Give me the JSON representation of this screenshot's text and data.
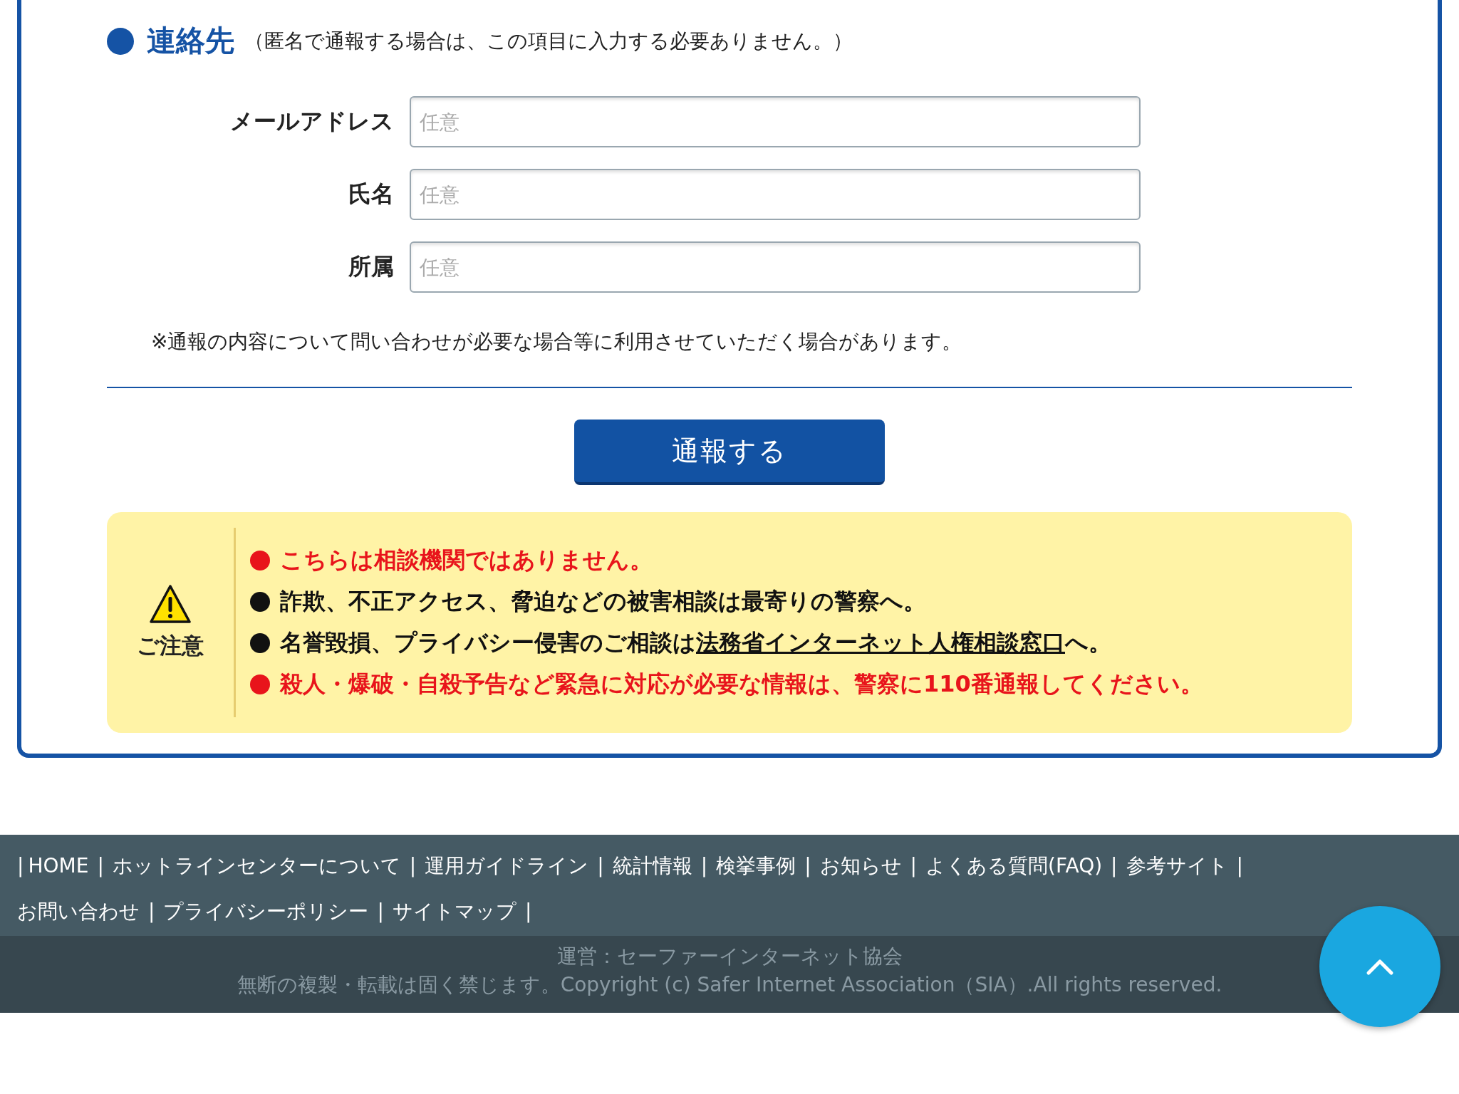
{
  "contact_section": {
    "title": "連絡先",
    "subtitle": "（匿名で通報する場合は、この項目に入力する必要ありません。）",
    "fields": [
      {
        "label": "メールアドレス",
        "placeholder": "任意"
      },
      {
        "label": "氏名",
        "placeholder": "任意"
      },
      {
        "label": "所属",
        "placeholder": "任意"
      }
    ],
    "note": "※通報の内容について問い合わせが必要な場合等に利用させていただく場合があります。"
  },
  "submit_button": "通報する",
  "notice": {
    "heading": "ご注意",
    "items": [
      {
        "kind": "alert",
        "text": "こちらは相談機関ではありません。"
      },
      {
        "kind": "info",
        "text": "詐欺、不正アクセス、脅迫などの被害相談は最寄りの警察へ。"
      },
      {
        "kind": "info",
        "text": "名誉毀損、プライバシー侵害のご相談は",
        "link": "法務省インターネット人権相談窓口",
        "after": "へ。"
      },
      {
        "kind": "alert",
        "text": "殺人・爆破・自殺予告など緊急に対応が必要な情報は、警察に110番通報してください。"
      }
    ]
  },
  "footer": {
    "separator": "|",
    "links": [
      "HOME",
      "ホットラインセンターについて",
      "運用ガイドライン",
      "統計情報",
      "検挙事例",
      "お知らせ",
      "よくある質問(FAQ)",
      "参考サイト",
      "お問い合わせ",
      "プライバシーポリシー",
      "サイトマップ"
    ],
    "operator": "運営：セーファーインターネット協会",
    "copyright": "無断の複製・転載は固く禁じます。Copyright (c) Safer Internet Association（SIA）.All rights reserved."
  }
}
